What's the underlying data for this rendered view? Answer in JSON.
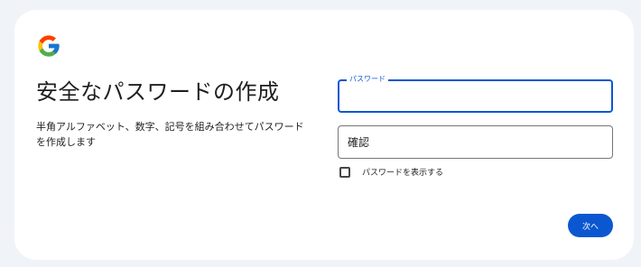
{
  "page": {
    "title": "安全なパスワードの作成",
    "description": "半角アルファベット、数字、記号を組み合わせてパスワードを作成します"
  },
  "logo": {
    "icon": "google-g-logo",
    "colors": [
      "#4285F4",
      "#34A853",
      "#FBBC05",
      "#EA4335"
    ]
  },
  "password_field": {
    "label": "パスワード",
    "value": "",
    "state": "focused"
  },
  "confirm_field": {
    "placeholder": "確認",
    "value": ""
  },
  "show_password": {
    "label": "パスワードを表示する",
    "checked": false
  },
  "next_button": {
    "label": "次へ"
  },
  "colors": {
    "accent": "#0b57d0",
    "background": "#f0f4f9",
    "card": "#ffffff",
    "text": "#1f1f1f"
  }
}
